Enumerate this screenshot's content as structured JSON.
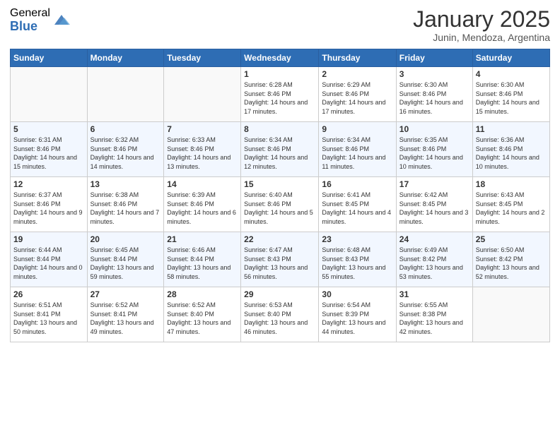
{
  "logo": {
    "general": "General",
    "blue": "Blue"
  },
  "header": {
    "month": "January 2025",
    "location": "Junin, Mendoza, Argentina"
  },
  "weekdays": [
    "Sunday",
    "Monday",
    "Tuesday",
    "Wednesday",
    "Thursday",
    "Friday",
    "Saturday"
  ],
  "weeks": [
    [
      {
        "day": "",
        "info": ""
      },
      {
        "day": "",
        "info": ""
      },
      {
        "day": "",
        "info": ""
      },
      {
        "day": "1",
        "info": "Sunrise: 6:28 AM\nSunset: 8:46 PM\nDaylight: 14 hours\nand 17 minutes."
      },
      {
        "day": "2",
        "info": "Sunrise: 6:29 AM\nSunset: 8:46 PM\nDaylight: 14 hours\nand 17 minutes."
      },
      {
        "day": "3",
        "info": "Sunrise: 6:30 AM\nSunset: 8:46 PM\nDaylight: 14 hours\nand 16 minutes."
      },
      {
        "day": "4",
        "info": "Sunrise: 6:30 AM\nSunset: 8:46 PM\nDaylight: 14 hours\nand 15 minutes."
      }
    ],
    [
      {
        "day": "5",
        "info": "Sunrise: 6:31 AM\nSunset: 8:46 PM\nDaylight: 14 hours\nand 15 minutes."
      },
      {
        "day": "6",
        "info": "Sunrise: 6:32 AM\nSunset: 8:46 PM\nDaylight: 14 hours\nand 14 minutes."
      },
      {
        "day": "7",
        "info": "Sunrise: 6:33 AM\nSunset: 8:46 PM\nDaylight: 14 hours\nand 13 minutes."
      },
      {
        "day": "8",
        "info": "Sunrise: 6:34 AM\nSunset: 8:46 PM\nDaylight: 14 hours\nand 12 minutes."
      },
      {
        "day": "9",
        "info": "Sunrise: 6:34 AM\nSunset: 8:46 PM\nDaylight: 14 hours\nand 11 minutes."
      },
      {
        "day": "10",
        "info": "Sunrise: 6:35 AM\nSunset: 8:46 PM\nDaylight: 14 hours\nand 10 minutes."
      },
      {
        "day": "11",
        "info": "Sunrise: 6:36 AM\nSunset: 8:46 PM\nDaylight: 14 hours\nand 10 minutes."
      }
    ],
    [
      {
        "day": "12",
        "info": "Sunrise: 6:37 AM\nSunset: 8:46 PM\nDaylight: 14 hours\nand 9 minutes."
      },
      {
        "day": "13",
        "info": "Sunrise: 6:38 AM\nSunset: 8:46 PM\nDaylight: 14 hours\nand 7 minutes."
      },
      {
        "day": "14",
        "info": "Sunrise: 6:39 AM\nSunset: 8:46 PM\nDaylight: 14 hours\nand 6 minutes."
      },
      {
        "day": "15",
        "info": "Sunrise: 6:40 AM\nSunset: 8:46 PM\nDaylight: 14 hours\nand 5 minutes."
      },
      {
        "day": "16",
        "info": "Sunrise: 6:41 AM\nSunset: 8:45 PM\nDaylight: 14 hours\nand 4 minutes."
      },
      {
        "day": "17",
        "info": "Sunrise: 6:42 AM\nSunset: 8:45 PM\nDaylight: 14 hours\nand 3 minutes."
      },
      {
        "day": "18",
        "info": "Sunrise: 6:43 AM\nSunset: 8:45 PM\nDaylight: 14 hours\nand 2 minutes."
      }
    ],
    [
      {
        "day": "19",
        "info": "Sunrise: 6:44 AM\nSunset: 8:44 PM\nDaylight: 14 hours\nand 0 minutes."
      },
      {
        "day": "20",
        "info": "Sunrise: 6:45 AM\nSunset: 8:44 PM\nDaylight: 13 hours\nand 59 minutes."
      },
      {
        "day": "21",
        "info": "Sunrise: 6:46 AM\nSunset: 8:44 PM\nDaylight: 13 hours\nand 58 minutes."
      },
      {
        "day": "22",
        "info": "Sunrise: 6:47 AM\nSunset: 8:43 PM\nDaylight: 13 hours\nand 56 minutes."
      },
      {
        "day": "23",
        "info": "Sunrise: 6:48 AM\nSunset: 8:43 PM\nDaylight: 13 hours\nand 55 minutes."
      },
      {
        "day": "24",
        "info": "Sunrise: 6:49 AM\nSunset: 8:42 PM\nDaylight: 13 hours\nand 53 minutes."
      },
      {
        "day": "25",
        "info": "Sunrise: 6:50 AM\nSunset: 8:42 PM\nDaylight: 13 hours\nand 52 minutes."
      }
    ],
    [
      {
        "day": "26",
        "info": "Sunrise: 6:51 AM\nSunset: 8:41 PM\nDaylight: 13 hours\nand 50 minutes."
      },
      {
        "day": "27",
        "info": "Sunrise: 6:52 AM\nSunset: 8:41 PM\nDaylight: 13 hours\nand 49 minutes."
      },
      {
        "day": "28",
        "info": "Sunrise: 6:52 AM\nSunset: 8:40 PM\nDaylight: 13 hours\nand 47 minutes."
      },
      {
        "day": "29",
        "info": "Sunrise: 6:53 AM\nSunset: 8:40 PM\nDaylight: 13 hours\nand 46 minutes."
      },
      {
        "day": "30",
        "info": "Sunrise: 6:54 AM\nSunset: 8:39 PM\nDaylight: 13 hours\nand 44 minutes."
      },
      {
        "day": "31",
        "info": "Sunrise: 6:55 AM\nSunset: 8:38 PM\nDaylight: 13 hours\nand 42 minutes."
      },
      {
        "day": "",
        "info": ""
      }
    ]
  ]
}
